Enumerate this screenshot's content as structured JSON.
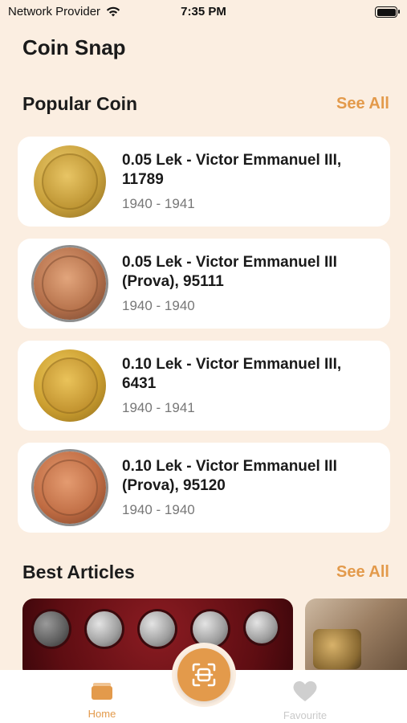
{
  "status_bar": {
    "carrier": "Network Provider",
    "time": "7:35 PM"
  },
  "app": {
    "title": "Coin Snap"
  },
  "popular": {
    "title": "Popular Coin",
    "see_all": "See All",
    "items": [
      {
        "name": "0.05 Lek - Victor Emmanuel III, 11789",
        "years": "1940 - 1941"
      },
      {
        "name": "0.05 Lek - Victor Emmanuel III (Prova), 95111",
        "years": "1940 - 1940"
      },
      {
        "name": "0.10 Lek - Victor Emmanuel III, 6431",
        "years": "1940 - 1941"
      },
      {
        "name": "0.10 Lek - Victor Emmanuel III (Prova), 95120",
        "years": "1940 - 1940"
      }
    ]
  },
  "articles": {
    "title": "Best Articles",
    "see_all": "See All"
  },
  "nav": {
    "home": "Home",
    "favourite": "Favourite"
  },
  "colors": {
    "accent": "#e39a4b",
    "background": "#fbeee1",
    "card": "#ffffff",
    "inactive": "#c9c9c9"
  },
  "icons": {
    "wifi": "wifi-icon",
    "battery": "battery-icon",
    "home": "home-icon",
    "scan": "scan-icon",
    "favourite": "heart-icon"
  }
}
